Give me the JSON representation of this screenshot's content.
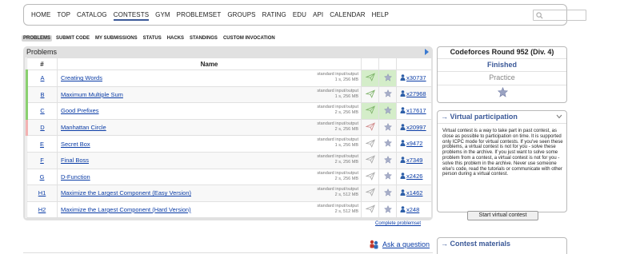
{
  "menu": {
    "items": [
      "HOME",
      "TOP",
      "CATALOG",
      "CONTESTS",
      "GYM",
      "PROBLEMSET",
      "GROUPS",
      "RATING",
      "EDU",
      "API",
      "CALENDAR",
      "HELP"
    ],
    "active": "CONTESTS"
  },
  "submenu": {
    "items": [
      "PROBLEMS",
      "SUBMIT CODE",
      "MY SUBMISSIONS",
      "STATUS",
      "HACKS",
      "STANDINGS",
      "CUSTOM INVOCATION"
    ],
    "active": "PROBLEMS"
  },
  "problems": {
    "caption": "Problems",
    "col_index": "#",
    "col_name": "Name",
    "rows": [
      {
        "index": "A",
        "name": "Creating Words",
        "io": "standard input/output",
        "limits": "1 s, 256 MB",
        "solved": "x30737",
        "status": "ok"
      },
      {
        "index": "B",
        "name": "Maximum Multiple Sum",
        "io": "standard input/output",
        "limits": "1 s, 256 MB",
        "solved": "x27968",
        "status": "ok"
      },
      {
        "index": "C",
        "name": "Good Prefixes",
        "io": "standard input/output",
        "limits": "2 s, 256 MB",
        "solved": "x17617",
        "status": "ok"
      },
      {
        "index": "D",
        "name": "Manhattan Circle",
        "io": "standard input/output",
        "limits": "2 s, 256 MB",
        "solved": "x20997",
        "status": "bad"
      },
      {
        "index": "E",
        "name": "Secret Box",
        "io": "standard input/output",
        "limits": "1 s, 256 MB",
        "solved": "x9472",
        "status": "none"
      },
      {
        "index": "F",
        "name": "Final Boss",
        "io": "standard input/output",
        "limits": "2 s, 256 MB",
        "solved": "x7349",
        "status": "none"
      },
      {
        "index": "G",
        "name": "D-Function",
        "io": "standard input/output",
        "limits": "2 s, 256 MB",
        "solved": "x2426",
        "status": "none"
      },
      {
        "index": "H1",
        "name": "Maximize the Largest Component (Easy Version)",
        "io": "standard input/output",
        "limits": "2 s, 512 MB",
        "solved": "x1462",
        "status": "none"
      },
      {
        "index": "H2",
        "name": "Maximize the Largest Component (Hard Version)",
        "io": "standard input/output",
        "limits": "2 s, 512 MB",
        "solved": "x248",
        "status": "none"
      }
    ],
    "complete_link": "Complete problemset"
  },
  "ask_link": "Ask a question",
  "round": {
    "title": "Codeforces Round 952 (Div. 4)",
    "phase": "Finished",
    "practice": "Practice"
  },
  "virtual": {
    "header": "→ Virtual participation",
    "text": "Virtual contest is a way to take part in past contest, as close as possible to participation on time. It is supported only ICPC mode for virtual contests. If you've seen these problems, a virtual contest is not for you - solve these problems in the archive. If you just want to solve some problem from a contest, a virtual contest is not for you - solve this problem in the archive. Never use someone else's code, read the tutorials or communicate with other person during a virtual contest.",
    "button": "Start virtual contest"
  },
  "materials": {
    "header": "→ Contest materials"
  },
  "colors": {
    "link": "#0a3ca6",
    "accepted": "#d4edc9",
    "rejected": "#fbdada",
    "accent": "#3b5998"
  }
}
